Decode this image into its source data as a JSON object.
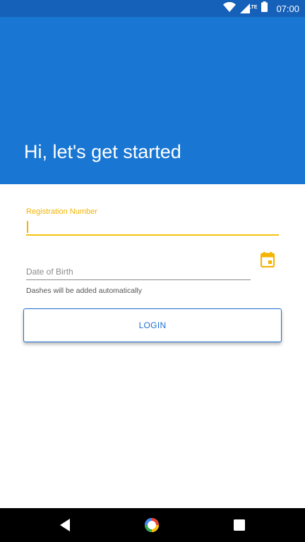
{
  "status_bar": {
    "time": "07:00",
    "network": "LTE",
    "icons": [
      "wifi-icon",
      "cell-signal-icon",
      "battery-icon"
    ]
  },
  "header": {
    "title": "Hi, let's get started"
  },
  "form": {
    "registration": {
      "label": "Registration Number",
      "value": ""
    },
    "dob": {
      "placeholder": "Date of Birth",
      "value": "",
      "hint": "Dashes will be added automatically",
      "icon": "calendar-icon"
    },
    "login_label": "LOGIN"
  },
  "nav_bar": {
    "icons": [
      "back-icon",
      "home-icon",
      "recents-icon"
    ]
  },
  "colors": {
    "header": "#1976d2",
    "status_bar": "#1560b8",
    "accent": "#f4b400",
    "button_border": "#1e6fd0"
  }
}
